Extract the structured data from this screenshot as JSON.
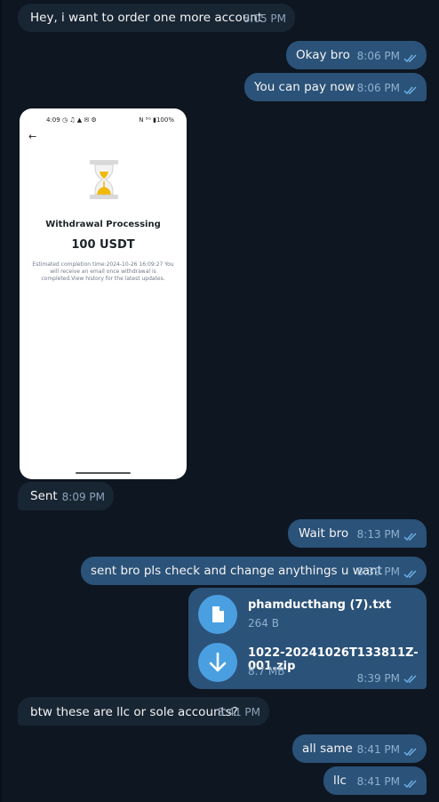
{
  "messages": [
    {
      "id": "m1",
      "dir": "in",
      "text": "Hey, i want to order one more account",
      "time": "8:05 PM"
    },
    {
      "id": "m2",
      "dir": "out",
      "text": "Okay bro",
      "time": "8:06 PM"
    },
    {
      "id": "m3",
      "dir": "out",
      "text": "You can pay now",
      "time": "8:06 PM"
    },
    {
      "id": "m4",
      "dir": "in",
      "text": "Sent",
      "time": "8:09 PM"
    },
    {
      "id": "m5",
      "dir": "out",
      "text": "Wait bro",
      "time": "8:13 PM"
    },
    {
      "id": "m6",
      "dir": "out",
      "text": "sent bro pls check and change anythings u want",
      "time": "8:39 PM"
    },
    {
      "id": "m7",
      "dir": "in",
      "text": "btw these are llc or sole accounts?",
      "time": "8:41 PM"
    },
    {
      "id": "m8",
      "dir": "out",
      "text": "all same",
      "time": "8:41 PM"
    },
    {
      "id": "m9",
      "dir": "out",
      "text": "llc",
      "time": "8:41 PM"
    }
  ],
  "photo": {
    "status_left": "4:09 ◷ ♫ ▲ ✉ ⚙",
    "status_right": "N ⁵ᴳ ▮100%",
    "title": "Withdrawal Processing",
    "amount": "100 USDT",
    "note": "Estimated completion time:2024-10-26 16:09:27 You will receive an email once withdrawal is completed.View history for the latest updates."
  },
  "files": {
    "items": [
      {
        "name": "phamducthang (7).txt",
        "size": "264 B",
        "icon": "document-icon"
      },
      {
        "name": "1022-20241026T133811Z-001.zip",
        "size": "8.7 MB",
        "icon": "download-icon"
      }
    ],
    "time": "8:39 PM"
  },
  "colors": {
    "background": "#0e1621",
    "incoming": "#182533",
    "outgoing": "#2b5278",
    "accent": "#4a9fe0"
  }
}
